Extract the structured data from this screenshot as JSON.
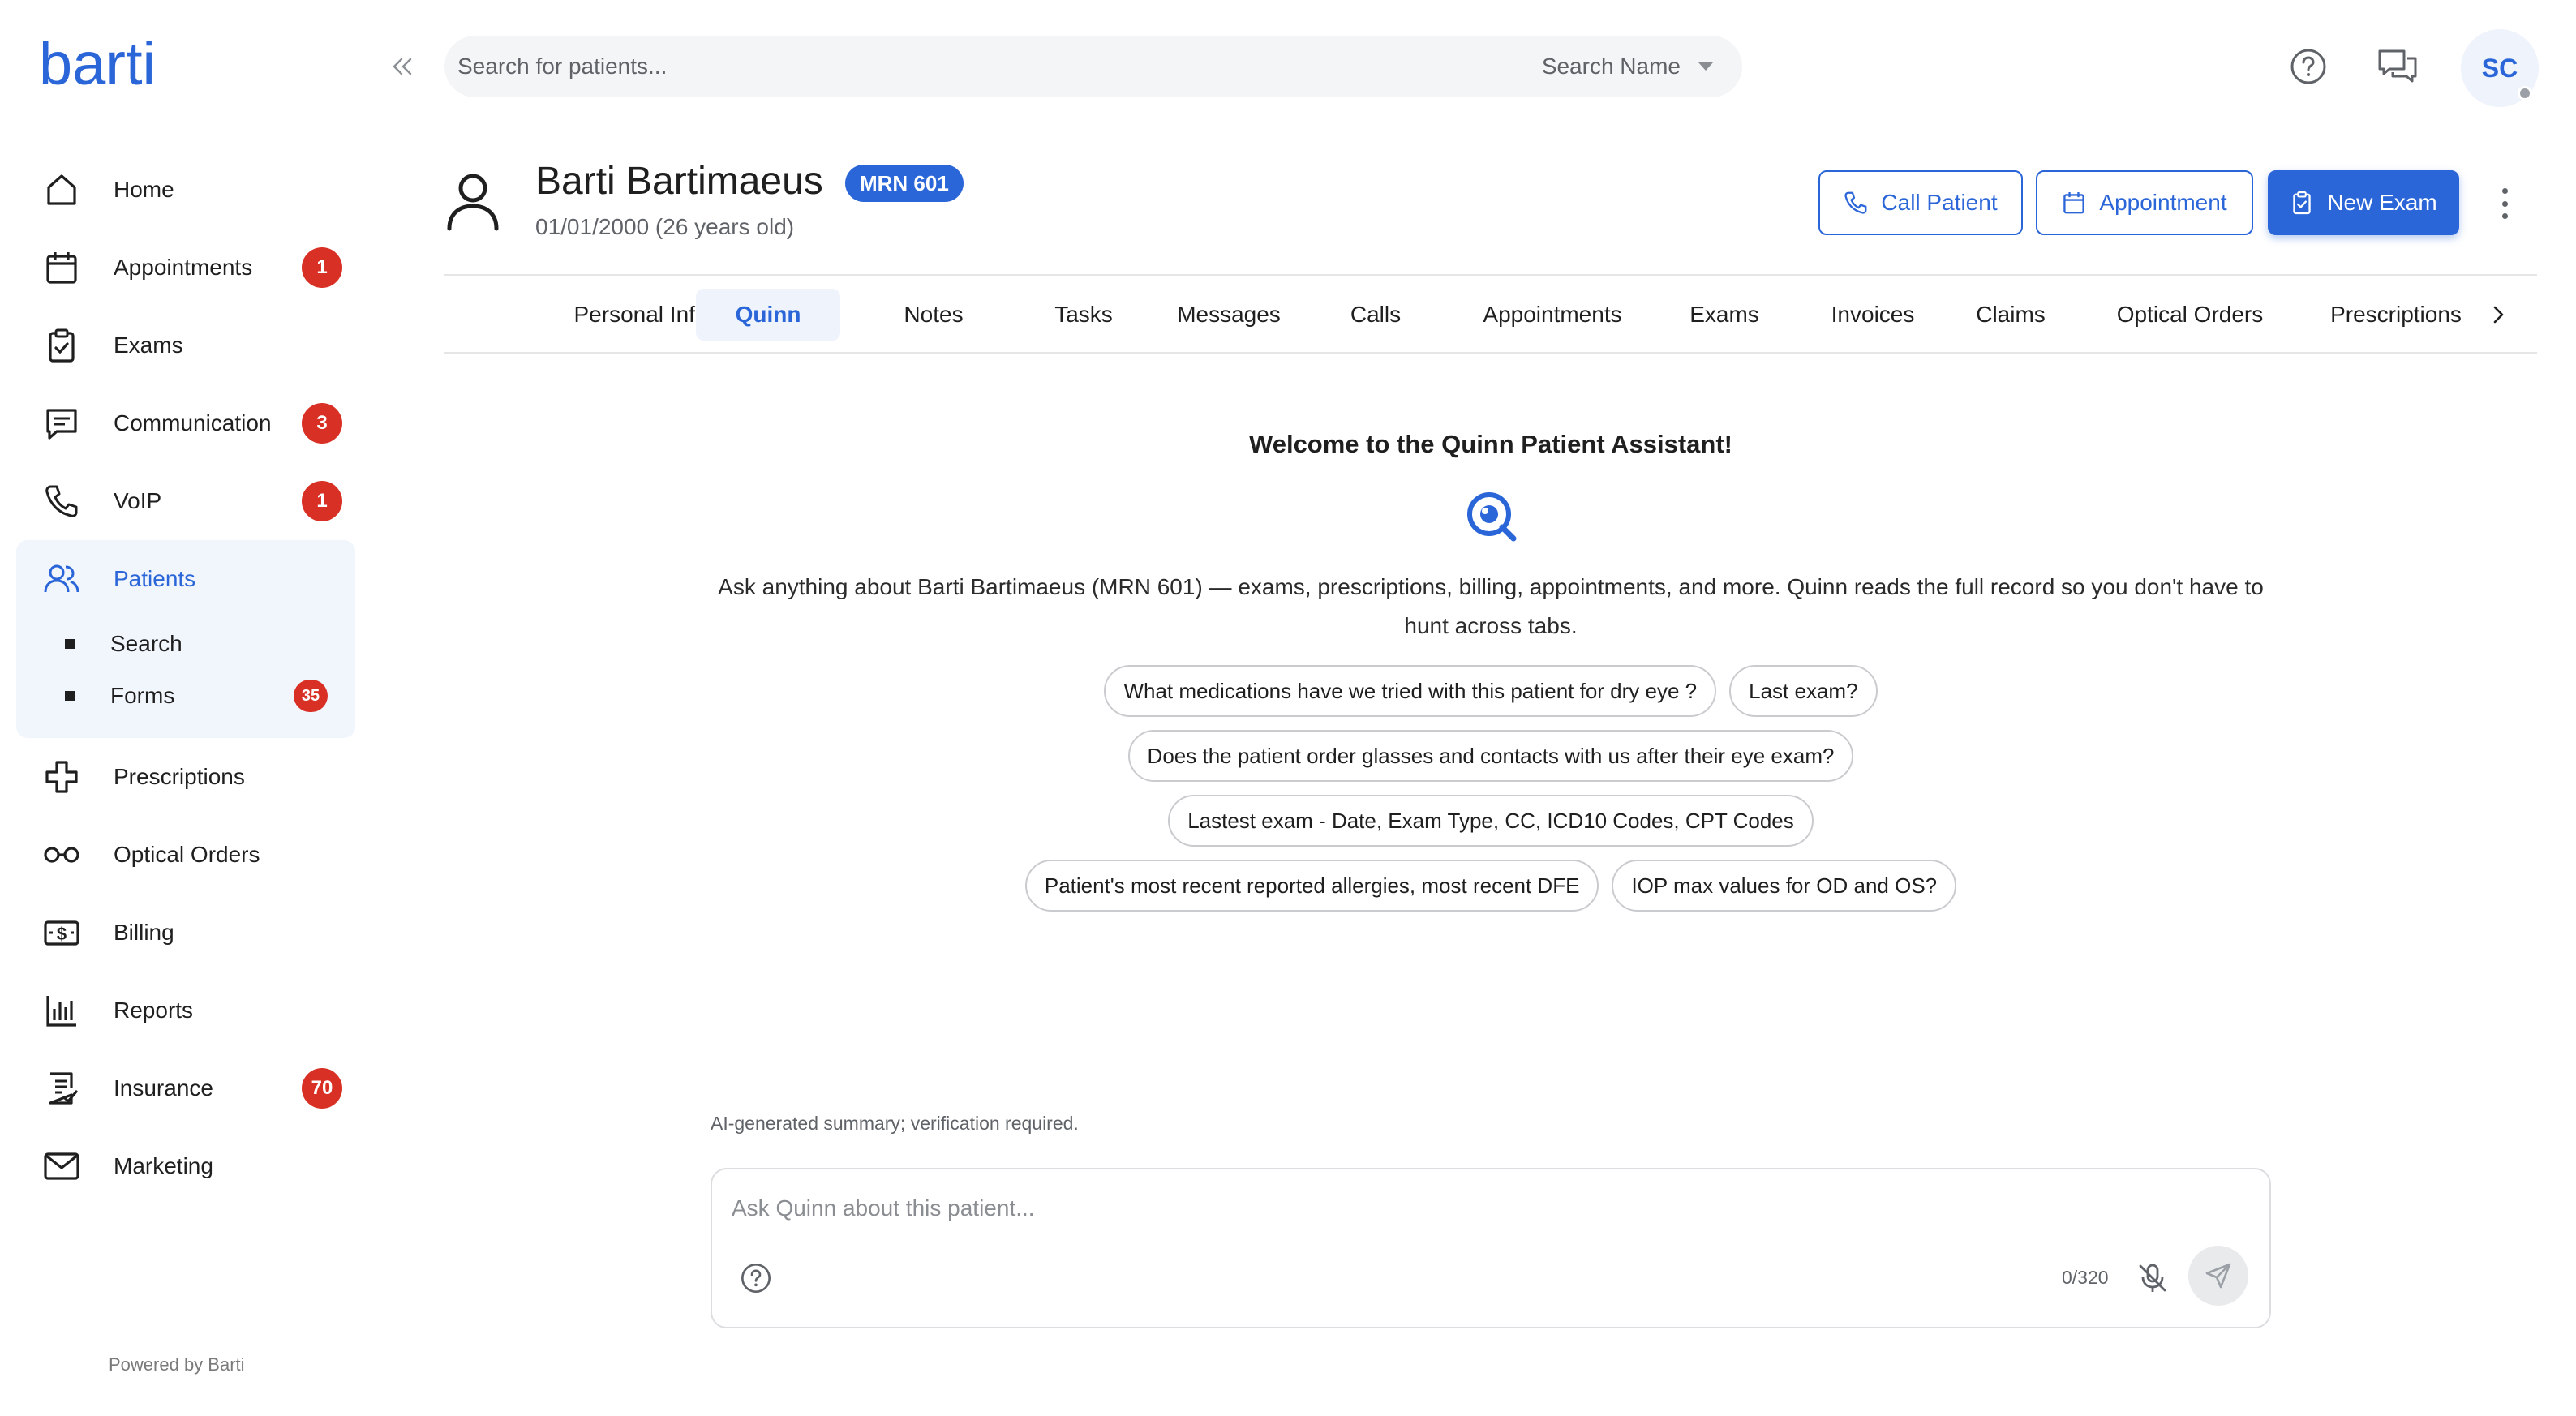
{
  "brand": {
    "logo_text": "barti",
    "accent": "#2b66d9",
    "badge_color": "#d93025"
  },
  "sidebar": {
    "items": [
      {
        "label": "Home",
        "icon": "home-icon"
      },
      {
        "label": "Appointments",
        "icon": "calendar-icon",
        "badge": "1"
      },
      {
        "label": "Exams",
        "icon": "clipboard-check-icon"
      },
      {
        "label": "Communication",
        "icon": "chat-icon",
        "badge": "3"
      },
      {
        "label": "VoIP",
        "icon": "phone-icon",
        "badge": "1"
      },
      {
        "label": "Patients",
        "icon": "users-icon",
        "active": true
      },
      {
        "label": "Prescriptions",
        "icon": "medical-cross-icon"
      },
      {
        "label": "Optical Orders",
        "icon": "glasses-icon"
      },
      {
        "label": "Billing",
        "icon": "billing-icon"
      },
      {
        "label": "Reports",
        "icon": "bar-chart-icon"
      },
      {
        "label": "Insurance",
        "icon": "insurance-doc-icon",
        "badge": "70"
      },
      {
        "label": "Marketing",
        "icon": "mail-icon"
      }
    ],
    "patients_sub": [
      {
        "label": "Search"
      },
      {
        "label": "Forms",
        "badge": "35"
      }
    ],
    "powered_by": "Powered by Barti"
  },
  "topbar": {
    "search_placeholder": "Search for patients...",
    "search_mode": "Search Name",
    "avatar_initials": "SC"
  },
  "patient": {
    "name": "Barti Bartimaeus",
    "mrn": "MRN 601",
    "dob": "01/01/2000 (26 years old)"
  },
  "actions": {
    "call": "Call Patient",
    "appointment": "Appointment",
    "new_exam": "New Exam"
  },
  "tabs": [
    {
      "label": "Personal Info"
    },
    {
      "label": "Quinn",
      "active": true
    },
    {
      "label": "Notes"
    },
    {
      "label": "Tasks"
    },
    {
      "label": "Messages"
    },
    {
      "label": "Calls"
    },
    {
      "label": "Appointments"
    },
    {
      "label": "Exams"
    },
    {
      "label": "Invoices"
    },
    {
      "label": "Claims"
    },
    {
      "label": "Optical Orders"
    },
    {
      "label": "Prescriptions"
    }
  ],
  "quinn": {
    "welcome": "Welcome to the Quinn Patient Assistant!",
    "intro": "Ask anything about Barti Bartimaeus (MRN 601) — exams, prescriptions, billing, appointments, and more. Quinn reads the full record so you don't have to hunt across tabs.",
    "suggestions": [
      [
        "What medications have we tried with this patient for dry eye ?",
        "Last exam?"
      ],
      [
        "Does the patient order glasses and contacts with us after their eye exam?"
      ],
      [
        "Lastest exam - Date, Exam Type, CC, ICD10 Codes, CPT Codes"
      ],
      [
        "Patient's most recent reported allergies, most recent DFE",
        "IOP max values for OD and OS?"
      ]
    ],
    "disclaimer": "AI-generated summary; verification required.",
    "input_placeholder": "Ask Quinn about this patient...",
    "char_count": "0/320"
  }
}
